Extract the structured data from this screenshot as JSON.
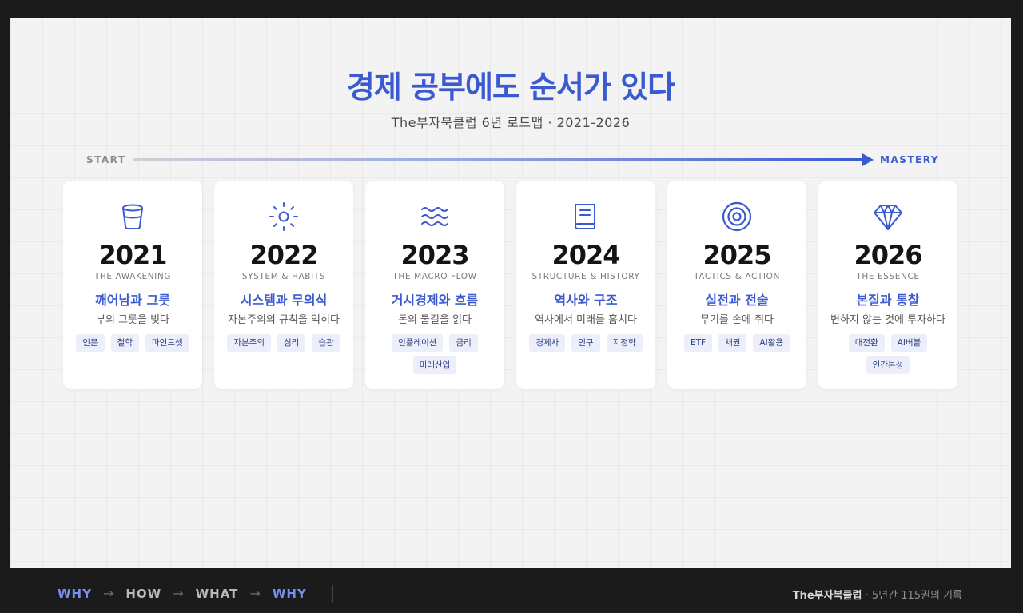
{
  "title": "경제 공부에도 순서가 있다",
  "subtitle": "The부자북클럽 6년 로드맵 · 2021-2026",
  "timeline": {
    "start": "START",
    "end": "MASTERY"
  },
  "colors": {
    "accent": "#3a5ad2",
    "tag_bg": "#eceff9",
    "frame": "#1b1b1b"
  },
  "cards": [
    {
      "icon": "cup-icon",
      "year": "2021",
      "en": "THE AWAKENING",
      "ko": "깨어남과 그릇",
      "desc": "부의 그릇을 빚다",
      "tags": [
        "인문",
        "철학",
        "마인드셋"
      ]
    },
    {
      "icon": "sun-icon",
      "year": "2022",
      "en": "SYSTEM & HABITS",
      "ko": "시스템과 무의식",
      "desc": "자본주의의 규칙을 익히다",
      "tags": [
        "자본주의",
        "심리",
        "습관"
      ]
    },
    {
      "icon": "waves-icon",
      "year": "2023",
      "en": "THE MACRO FLOW",
      "ko": "거시경제와 흐름",
      "desc": "돈의 물길을 읽다",
      "tags": [
        "인플레이션",
        "금리",
        "미래산업"
      ]
    },
    {
      "icon": "book-icon",
      "year": "2024",
      "en": "STRUCTURE & HISTORY",
      "ko": "역사와 구조",
      "desc": "역사에서 미래를 훔치다",
      "tags": [
        "경제사",
        "인구",
        "지정학"
      ]
    },
    {
      "icon": "target-icon",
      "year": "2025",
      "en": "TACTICS & ACTION",
      "ko": "실전과 전술",
      "desc": "무기를 손에 쥐다",
      "tags": [
        "ETF",
        "채권",
        "AI활용"
      ]
    },
    {
      "icon": "diamond-icon",
      "year": "2026",
      "en": "THE ESSENCE",
      "ko": "본질과 통찰",
      "desc": "변하지 않는 것에 투자하다",
      "tags": [
        "대전환",
        "AI버블",
        "인간본성"
      ]
    }
  ],
  "footer": {
    "flow": [
      "WHY",
      "HOW",
      "WHAT",
      "WHY"
    ],
    "arrow": "→",
    "brand_name": "The부자북클럽",
    "brand_sep": " · ",
    "brand_note": "5년간 115권의 기록"
  }
}
